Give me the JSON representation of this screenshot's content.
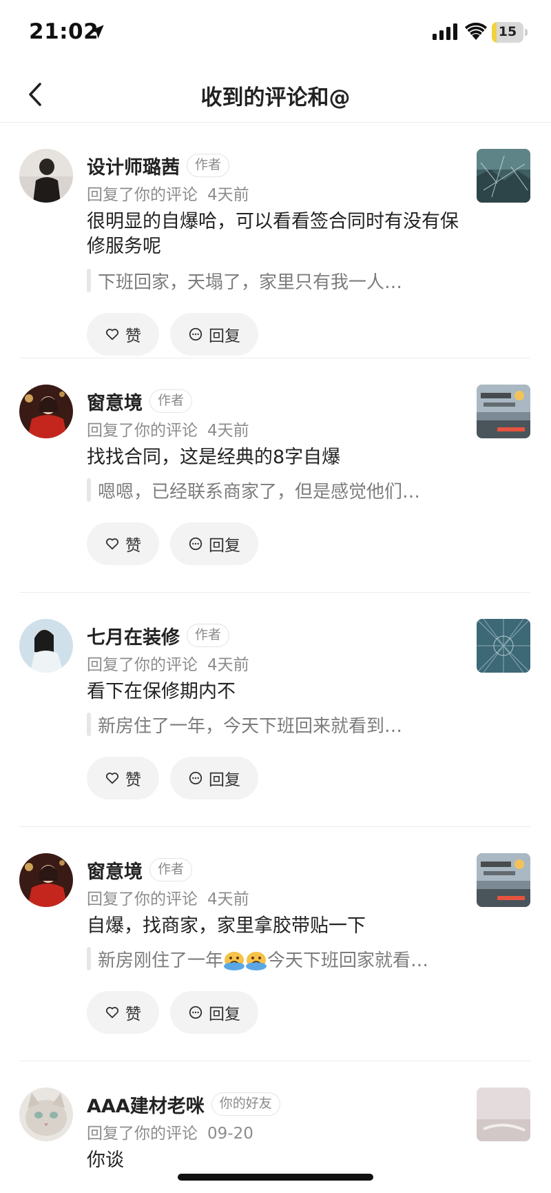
{
  "status_bar": {
    "time": "21:02",
    "battery_level": "15",
    "battery_fraction": 0.15
  },
  "nav": {
    "title": "收到的评论和@"
  },
  "actions": {
    "like_label": "赞",
    "reply_label": "回复"
  },
  "items": [
    {
      "user": "设计师璐茜",
      "tag": "作者",
      "action_text": "回复了你的评论",
      "time": "4天前",
      "comment": "很明显的自爆哈，可以看看签合同时有没有保修服务呢",
      "quote": "下班回家，天塌了，家里只有我一人…"
    },
    {
      "user": "窗意境",
      "tag": "作者",
      "action_text": "回复了你的评论",
      "time": "4天前",
      "comment": "找找合同，这是经典的8字自爆",
      "quote": "嗯嗯，已经联系商家了，但是感觉他们…"
    },
    {
      "user": "七月在装修",
      "tag": "作者",
      "action_text": "回复了你的评论",
      "time": "4天前",
      "comment": "看下在保修期内不",
      "quote": "新房住了一年，今天下班回来就看到…"
    },
    {
      "user": "窗意境",
      "tag": "作者",
      "action_text": "回复了你的评论",
      "time": "4天前",
      "comment": "自爆，找商家，家里拿胶带贴一下",
      "quote_before": "新房刚住了一年",
      "quote_after": "今天下班回家就看…",
      "quote_emojis": [
        "crying-face-emoji",
        "crying-face-emoji"
      ]
    },
    {
      "user": "AAA建材老咪",
      "tag": "你的好友",
      "action_text": "回复了你的评论",
      "time": "09-20",
      "comment": "你谈"
    }
  ]
}
